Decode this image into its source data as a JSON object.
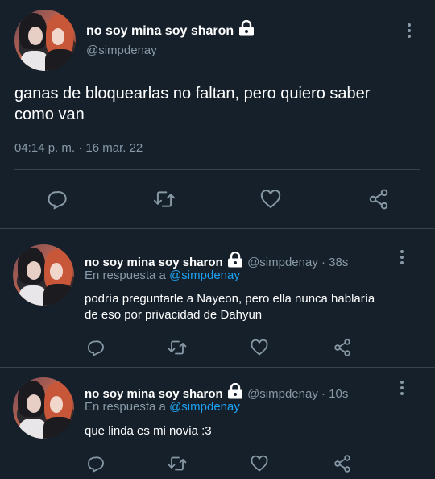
{
  "main_tweet": {
    "display_name": "no soy mina soy sharon",
    "handle": "@simpdenay",
    "text_line1": "ganas de bloquearlas no faltan, pero quiero saber",
    "text_line2": "como van",
    "timestamp": "04:14 p. m. · 16 mar. 22"
  },
  "replies": [
    {
      "display_name": "no soy mina soy sharon",
      "handle_time": "@simpdenay · 38s",
      "reply_prefix": "En respuesta a",
      "reply_to": "@simpdenay",
      "text_line1": "podría preguntarle a Nayeon, pero ella nunca hablaría",
      "text_line2": "de eso por privacidad de Dahyun"
    },
    {
      "display_name": "no soy mina soy sharon",
      "handle_time": "@simpdenay · 10s",
      "reply_prefix": "En respuesta a",
      "reply_to": "@simpdenay",
      "text_line1": "que linda es mi novia :3"
    }
  ],
  "icons": [
    "reply-icon",
    "retweet-icon",
    "like-icon",
    "share-icon",
    "lock-icon",
    "more-icon"
  ],
  "colors": {
    "background": "#15202b",
    "muted": "#8899a6",
    "link": "#1da1f2",
    "divider": "#38444d"
  }
}
